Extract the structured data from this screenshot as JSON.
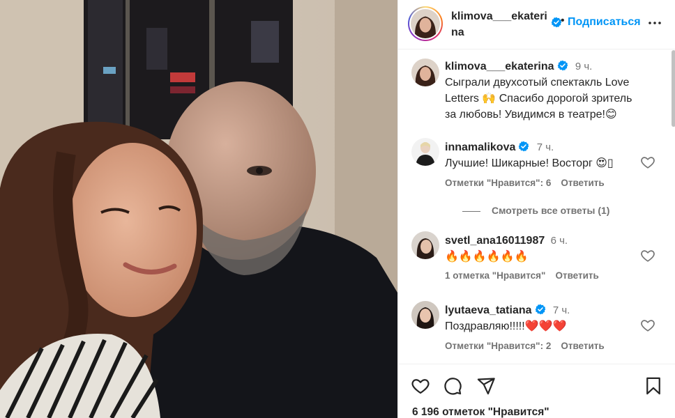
{
  "post": {
    "username_line1": "klimova___ekateri",
    "username_line2": "na",
    "follow_label": "Подписаться",
    "separator": "•",
    "caption": {
      "username": "klimova___ekaterina",
      "time": "9 ч.",
      "text": "Сыграли двухсотый спектакль Love Letters 🙌 Спасибо дорогой зритель за любовь! Увидимся в театре!😊"
    },
    "likes_label": "6 196 отметок \"Нравится\""
  },
  "comments": [
    {
      "username": "innamalikova",
      "time": "7 ч.",
      "text": "Лучшие! Шикарные! Восторг 😍▯",
      "likes": "Отметки \"Нравится\": 6",
      "reply": "Ответить"
    },
    {
      "username": "svetl_ana16011987",
      "time": "6 ч.",
      "text": "🔥🔥🔥🔥🔥🔥",
      "likes": "1 отметка \"Нравится\"",
      "reply": "Ответить"
    },
    {
      "username": "lyutaeva_tatiana",
      "time": "7 ч.",
      "text": "Поздравляю!!!!!❤️❤️❤️",
      "likes": "Отметки \"Нравится\": 2",
      "reply": "Ответить"
    }
  ],
  "view_replies": "Смотреть все ответы (1)",
  "colors": {
    "accent": "#0095f6",
    "verified": "#0095f6",
    "muted": "#737373"
  },
  "icons": [
    "more-icon",
    "heart-icon",
    "comment-icon",
    "share-icon",
    "bookmark-icon",
    "verified-icon"
  ]
}
